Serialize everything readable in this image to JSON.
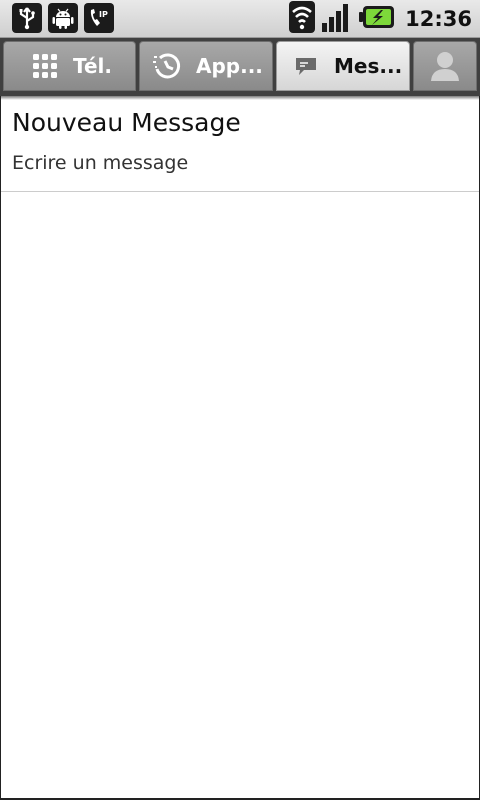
{
  "status_bar": {
    "time": "12:36",
    "left_icons": [
      "usb-icon",
      "android-debug-icon",
      "sip-call-icon"
    ],
    "right_icons": [
      "wifi-icon",
      "signal-icon",
      "battery-charging-icon"
    ]
  },
  "tabs": [
    {
      "label": "Tél.",
      "icon": "dialpad-icon",
      "selected": false
    },
    {
      "label": "App...",
      "icon": "recent-calls-icon",
      "selected": false
    },
    {
      "label": "Mes...",
      "icon": "message-icon",
      "selected": true
    },
    {
      "label": "",
      "icon": "contact-icon",
      "selected": false
    }
  ],
  "list": {
    "items": [
      {
        "title": "Nouveau Message",
        "subtitle": "Ecrire un message"
      }
    ]
  },
  "colors": {
    "tab_bar": "#404040",
    "tab_selected": "#e6e6e6",
    "tab_unselected": "#999999",
    "background": "#ffffff"
  }
}
